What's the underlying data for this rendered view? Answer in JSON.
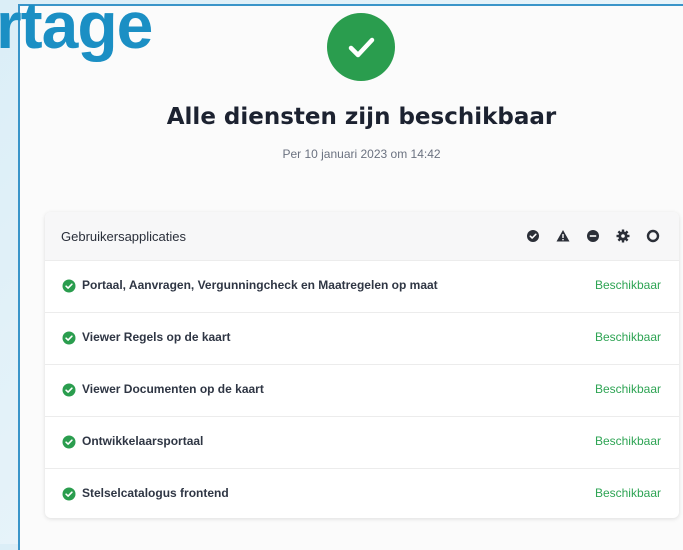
{
  "background": {
    "partial_word": "rtage"
  },
  "status": {
    "icon": "check-circle-icon",
    "headline": "Alle diensten zijn beschikbaar",
    "timestamp": "Per 10 januari 2023 om 14:42"
  },
  "card": {
    "title": "Gebruikersapplicaties",
    "legend_icons": [
      "check-circle-icon",
      "warning-triangle-icon",
      "minus-circle-icon",
      "gear-icon",
      "circle-outline-icon"
    ],
    "services": [
      {
        "name": "Portaal, Aanvragen, Vergunningcheck en Maatregelen op maat",
        "state": "Beschikbaar"
      },
      {
        "name": "Viewer Regels op de kaart",
        "state": "Beschikbaar"
      },
      {
        "name": "Viewer Documenten op de kaart",
        "state": "Beschikbaar"
      },
      {
        "name": "Ontwikkelaarsportaal",
        "state": "Beschikbaar"
      },
      {
        "name": "Stelselcatalogus frontend",
        "state": "Beschikbaar"
      }
    ]
  },
  "colors": {
    "success": "#2a9d4e",
    "available_text": "#2ea454",
    "background_word": "#1b8fc4"
  }
}
